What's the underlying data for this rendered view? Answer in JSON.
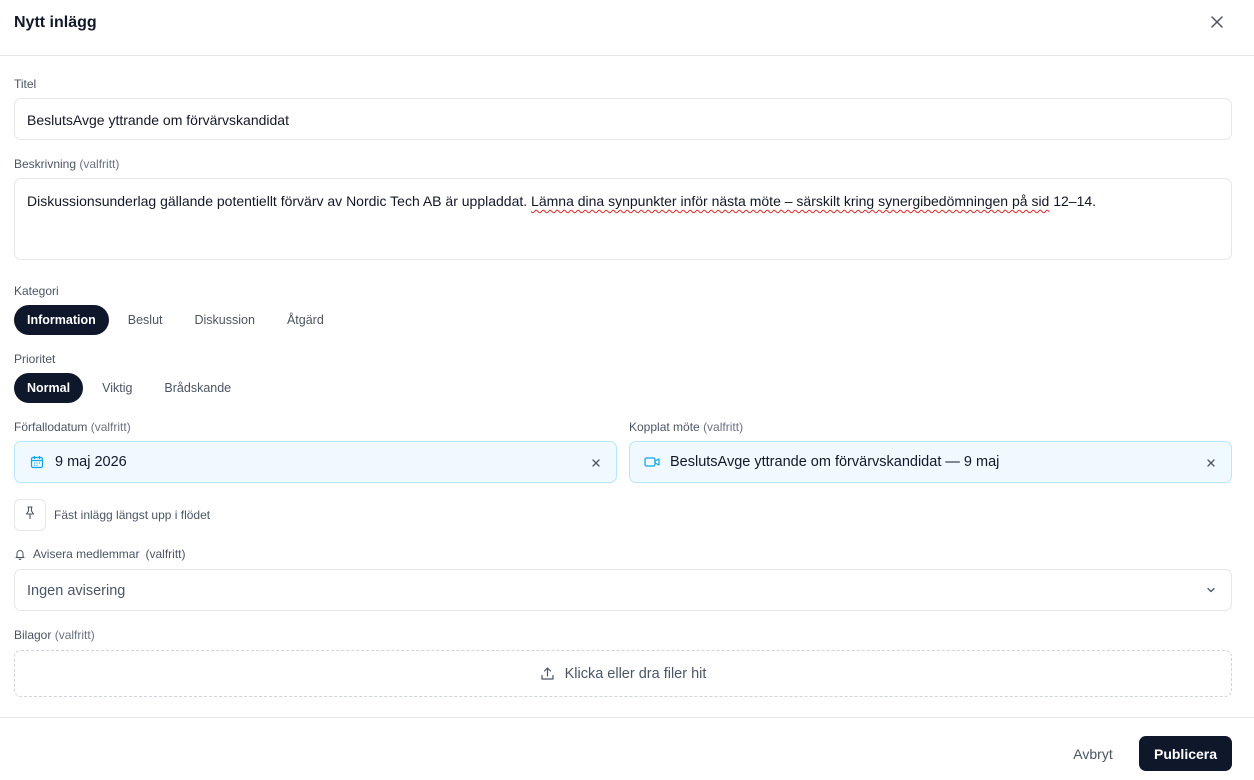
{
  "dialog": {
    "title": "Nytt inlägg",
    "close_icon": "close-icon"
  },
  "fields": {
    "title": {
      "label": "Titel",
      "value": "BeslutsAvge yttrande om förvärvskandidat"
    },
    "description": {
      "label": "Beskrivning",
      "optional": "(valfritt)",
      "value_part1": "Diskussionsunderlag gällande potentiellt förvärv av Nordic Tech AB är uppladdat. ",
      "value_part2": "Lämna dina synpunkter inför nästa möte – särskilt kring synergibedömningen på sid",
      "value_part3": " 12–14."
    },
    "category": {
      "label": "Kategori",
      "options": [
        "Information",
        "Beslut",
        "Diskussion",
        "Åtgärd"
      ],
      "selected": "Information"
    },
    "priority": {
      "label": "Prioritet",
      "options": [
        "Normal",
        "Viktig",
        "Brådskande"
      ],
      "selected": "Normal"
    },
    "due_date": {
      "label": "Förfallodatum",
      "optional": "(valfritt)",
      "value": "9 maj 2026",
      "icon": "calendar-icon"
    },
    "linked_meeting": {
      "label": "Kopplat möte",
      "optional": "(valfritt)",
      "value": "BeslutsAvge yttrande om förvärvskandidat — 9 maj",
      "icon": "video-icon"
    },
    "pin": {
      "label": "Fäst inlägg längst upp i flödet",
      "icon": "pin-icon"
    },
    "notify": {
      "label": "Avisera medlemmar",
      "optional": "(valfritt)",
      "value": "Ingen avisering",
      "icon": "bell-icon"
    },
    "attachments": {
      "label": "Bilagor",
      "optional": "(valfritt)",
      "dropzone_text": "Klicka eller dra filer hit",
      "icon": "upload-icon"
    }
  },
  "footer": {
    "cancel_label": "Avbryt",
    "publish_label": "Publicera"
  },
  "colors": {
    "primary": "#0f172a",
    "chip_bg": "#f0f9ff",
    "chip_border": "#bae6fd",
    "accent_icon": "#0ea5e9"
  }
}
